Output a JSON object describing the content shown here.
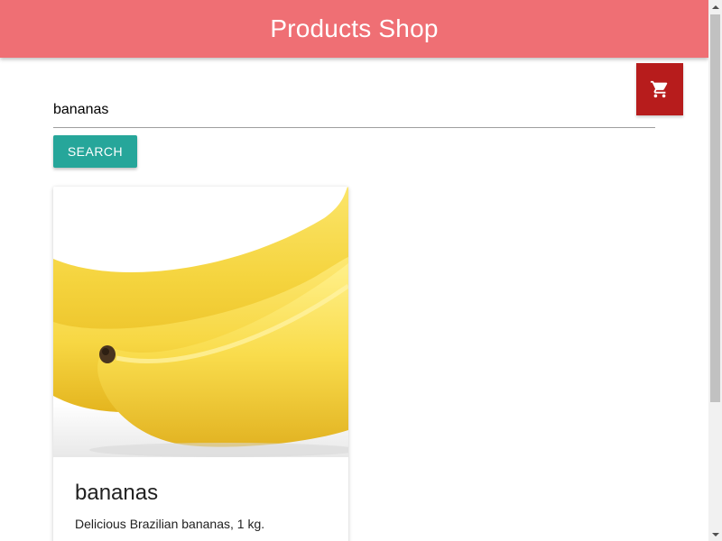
{
  "header": {
    "title": "Products Shop",
    "background_color": "#ef6f74"
  },
  "cart": {
    "icon": "shopping-cart-icon",
    "background_color": "#b71c1c"
  },
  "search": {
    "value": "bananas",
    "button_label": "Search",
    "button_color": "#26a69a"
  },
  "products": [
    {
      "name": "bananas",
      "description": "Delicious Brazilian bananas, 1 kg.",
      "image_alt": "bananas"
    }
  ]
}
